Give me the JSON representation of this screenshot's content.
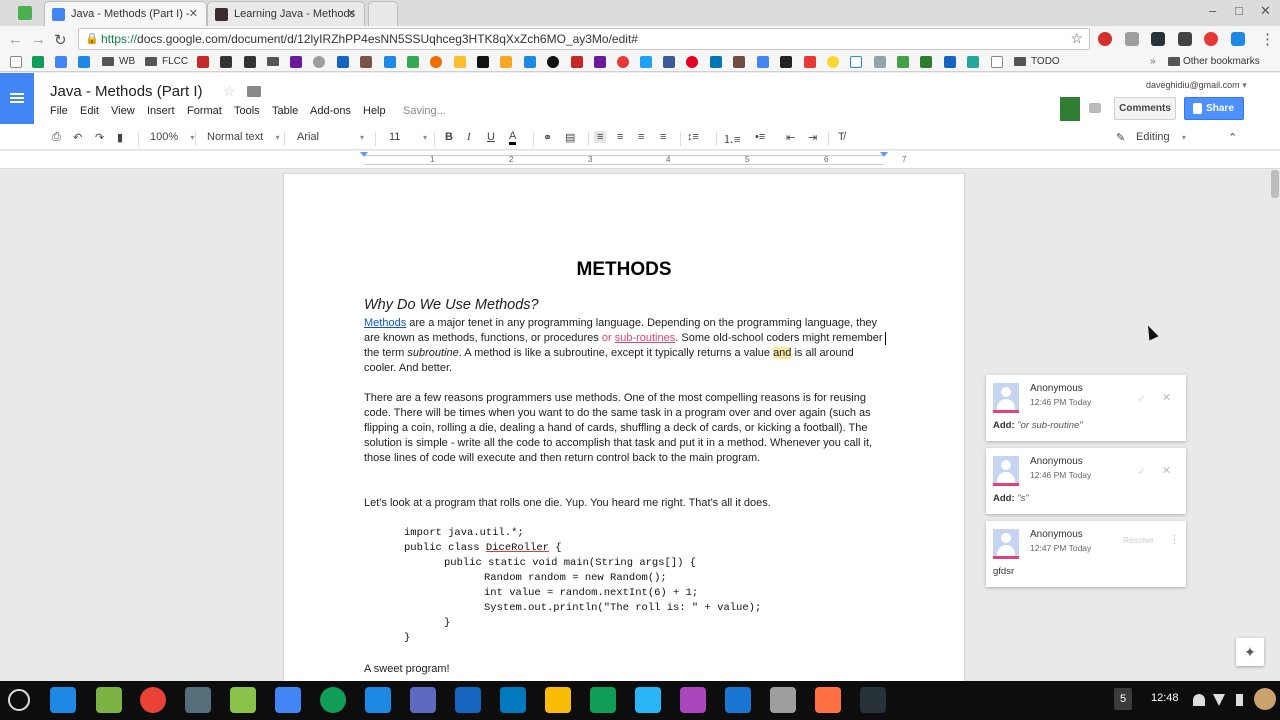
{
  "browser": {
    "tabs": [
      {
        "title": "Java - Methods (Part I) -",
        "active": true
      },
      {
        "title": "Learning Java - Methods",
        "active": false
      }
    ],
    "url_scheme": "https://",
    "url_rest": "docs.google.com/document/d/12lyIRZhPP4esNN5SSUqhceg3HTK8qXxZch6MO_ay3Mo/edit#",
    "bookmarks": [
      "WB",
      "FLCC",
      "TODO",
      "Other bookmarks"
    ]
  },
  "docs": {
    "title": "Java - Methods (Part I)",
    "menu": [
      "File",
      "Edit",
      "View",
      "Insert",
      "Format",
      "Tools",
      "Table",
      "Add-ons",
      "Help"
    ],
    "status": "Saving...",
    "user_email": "daveghidiu@gmail.com",
    "comments_label": "Comments",
    "share_label": "Share",
    "toolbar": {
      "zoom": "100%",
      "style": "Normal text",
      "font": "Arial",
      "font_size": "11",
      "bold": "B",
      "italic": "I",
      "underline": "U",
      "text_color": "A",
      "mode": "Editing"
    },
    "ruler_numbers": [
      "1",
      "2",
      "3",
      "4",
      "5",
      "6",
      "7"
    ]
  },
  "document": {
    "heading": "METHODS",
    "subheading": "Why Do We Use Methods?",
    "p1": {
      "link": "Methods",
      "a": " are a major tenet in any programming language. Depending on the programming language, they are known as methods, functions, or procedures",
      "ins1": " or ",
      "ins2": "sub-routines",
      "b": ". Some old-school coders might remember the term ",
      "em": "subroutine",
      "c": ". A method is like a subroutine, except it typically returns a value ",
      "hl": "and",
      "d": " is all around cooler. And better."
    },
    "p2": "There are a few reasons programmers use methods. One of the most compelling reasons is for reusing code. There will be times when you want to do the same task in a program over and over again (such as flipping a coin, rolling a die, dealing a hand of cards, shuffling a deck of cards, or kicking a football). The solution is simple - write all the code to accomplish that task and put it in a method. Whenever you call it, those lines of code will execute and then return control back to the main program.",
    "p3": "Let's look at a program that rolls one die. Yup. You heard me right. That's all it does.",
    "code": {
      "line1": "import java.util.*;",
      "line2_a": "public class ",
      "line2_b": "DiceRoller",
      "line2_c": " {",
      "line3": "public static void main(String args[]) {",
      "line4": "Random random = new Random();",
      "line5": "int value = random.nextInt(6) + 1;",
      "line6": "System.out.println(\"The roll is: \" + value);",
      "line7": "}",
      "line8": "}"
    },
    "p4": "A sweet program!"
  },
  "comments": [
    {
      "author": "Anonymous",
      "time": "12:46 PM Today",
      "prefix": "Add:",
      "text": "\"or sub-routine\""
    },
    {
      "author": "Anonymous",
      "time": "12:46 PM Today",
      "prefix": "Add:",
      "text": "\"s\""
    },
    {
      "author": "Anonymous",
      "time": "12:47 PM Today",
      "resolve": "Resolve",
      "body": "gfdsr"
    }
  ],
  "shelf": {
    "badge": "5",
    "clock": "12:48"
  }
}
